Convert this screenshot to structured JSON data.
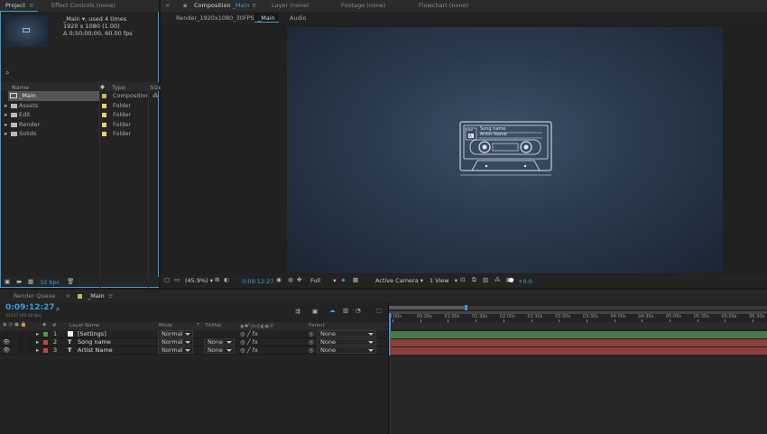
{
  "project_panel": {
    "tabs": [
      "Project",
      "Effect Controls (none)"
    ],
    "menu_icon": "≡",
    "preview": {
      "name": "_Main ▾",
      "used": ", used 4 times",
      "resolution": "1920 x 1080 (1.00)",
      "duration": "Δ 0;50;00;00, 60.00 fps"
    },
    "search_icon": "magnifier-icon",
    "columns": {
      "name": "Name",
      "type": "Type",
      "size": "Size"
    },
    "items": [
      {
        "name": "_Main",
        "type": "Composition",
        "color": "#c9b56a",
        "kind": "comp",
        "selected": true
      },
      {
        "name": "Assets",
        "type": "Folder",
        "color": "#e8d06a",
        "kind": "folder",
        "selected": false
      },
      {
        "name": "Edit",
        "type": "Folder",
        "color": "#e8d06a",
        "kind": "folder",
        "selected": false
      },
      {
        "name": "Render",
        "type": "Folder",
        "color": "#e8d06a",
        "kind": "folder",
        "selected": false
      },
      {
        "name": "Solids",
        "type": "Folder",
        "color": "#e8d06a",
        "kind": "folder",
        "selected": false
      }
    ],
    "bpc": "32 bpc"
  },
  "comp_panel": {
    "tabs": {
      "comp_prefix": "Composition",
      "comp_name": "_Main",
      "layer": "Layer (none)",
      "footage": "Footage (none)",
      "flowchart": "Flowchart (none)"
    },
    "close": "×",
    "lock": "🔒",
    "sub_tabs": [
      "Render_1920x1080_30FPS",
      "_Main",
      "Audio"
    ],
    "cassette": {
      "song": "Song name",
      "artist": "Artist Name",
      "side": "SIDE",
      "side_letter": "A"
    },
    "footer": {
      "zoom": "(45.9%)",
      "timecode": "0:09:12:27",
      "resolution": "Full",
      "camera": "Active Camera",
      "view": "1 View",
      "exposure": "+0.0"
    }
  },
  "timeline": {
    "tabs": [
      "Render Queue",
      "_Main"
    ],
    "timecode": "0:09:12:27",
    "frames": "33147 (60.00 fps)",
    "columns": {
      "hash": "#",
      "layer_name": "Layer Name",
      "mode": "Mode",
      "t": "T",
      "trkmat": "TrkMat",
      "parent": "Parent"
    },
    "layers": [
      {
        "num": "1",
        "name": "[Settings]",
        "mode": "Normal",
        "trkmat": "",
        "parent": "None",
        "color": "#4a9a4a",
        "bar": "#497b49"
      },
      {
        "num": "2",
        "name": "Song name",
        "mode": "Normal",
        "trkmat": "None",
        "parent": "None",
        "color": "#c24444",
        "bar": "#8c3f3f"
      },
      {
        "num": "3",
        "name": "Artist Name",
        "mode": "Normal",
        "trkmat": "None",
        "parent": "None",
        "color": "#c24444",
        "bar": "#8c3f3f"
      }
    ],
    "ruler": [
      "0:00s",
      "00:30s",
      "01:00s",
      "01:30s",
      "02:00s",
      "02:30s",
      "03:00s",
      "03:30s",
      "04:00s",
      "04:30s",
      "05:00s",
      "05:30s",
      "06:00s",
      "06:30s"
    ]
  }
}
